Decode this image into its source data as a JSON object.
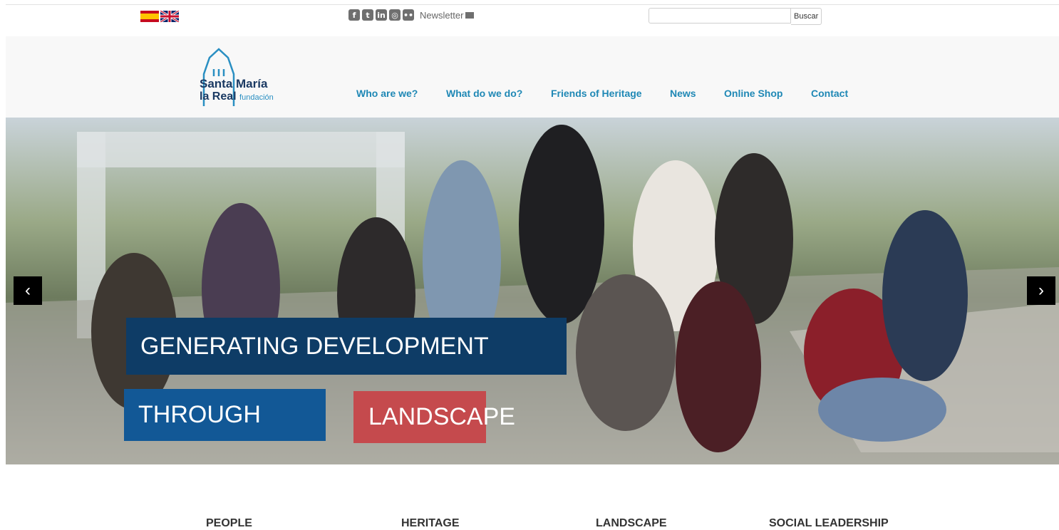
{
  "top_bar": {
    "languages": [
      "Español",
      "English"
    ],
    "social_icons": [
      "facebook-icon",
      "twitter-icon",
      "linkedin-icon",
      "instagram-icon",
      "flickr-icon"
    ],
    "newsletter_label": "Newsletter",
    "search": {
      "value": "",
      "button_label": "Buscar"
    }
  },
  "logo": {
    "line1": "Santa María",
    "line2": "la Real",
    "line3": "fundación"
  },
  "nav": {
    "items": [
      "Who are we?",
      "What do we do?",
      "Friends of Heritage",
      "News",
      "Online Shop",
      "Contact"
    ]
  },
  "hero": {
    "line1": "GENERATING DEVELOPMENT",
    "line2": "THROUGH",
    "line3": "LANDSCAPE",
    "prev_label": "‹",
    "next_label": "›"
  },
  "pillars": [
    "PEOPLE",
    "HERITAGE",
    "LANDSCAPE",
    "SOCIAL LEADERSHIP"
  ],
  "colors": {
    "nav": "#1f88b5",
    "caption_dark": "#0e3c66",
    "caption_blue": "#125896",
    "caption_red": "#c54a4d"
  }
}
